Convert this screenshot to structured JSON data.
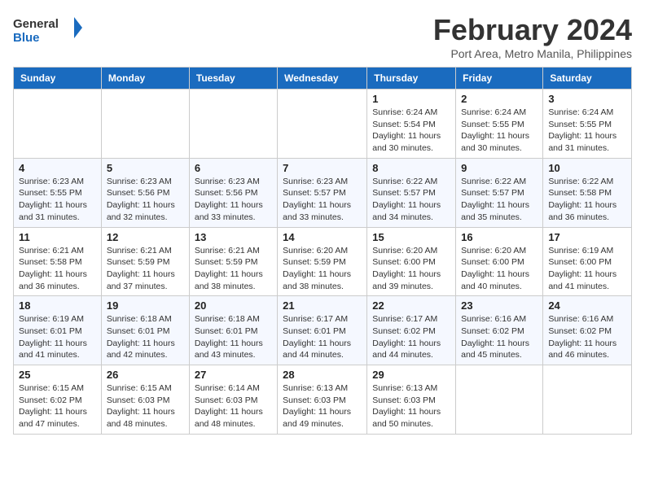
{
  "logo": {
    "line1": "General",
    "line2": "Blue"
  },
  "title": "February 2024",
  "location": "Port Area, Metro Manila, Philippines",
  "days_of_week": [
    "Sunday",
    "Monday",
    "Tuesday",
    "Wednesday",
    "Thursday",
    "Friday",
    "Saturday"
  ],
  "weeks": [
    [
      {
        "day": "",
        "info": ""
      },
      {
        "day": "",
        "info": ""
      },
      {
        "day": "",
        "info": ""
      },
      {
        "day": "",
        "info": ""
      },
      {
        "day": "1",
        "info": "Sunrise: 6:24 AM\nSunset: 5:54 PM\nDaylight: 11 hours and 30 minutes."
      },
      {
        "day": "2",
        "info": "Sunrise: 6:24 AM\nSunset: 5:55 PM\nDaylight: 11 hours and 30 minutes."
      },
      {
        "day": "3",
        "info": "Sunrise: 6:24 AM\nSunset: 5:55 PM\nDaylight: 11 hours and 31 minutes."
      }
    ],
    [
      {
        "day": "4",
        "info": "Sunrise: 6:23 AM\nSunset: 5:55 PM\nDaylight: 11 hours and 31 minutes."
      },
      {
        "day": "5",
        "info": "Sunrise: 6:23 AM\nSunset: 5:56 PM\nDaylight: 11 hours and 32 minutes."
      },
      {
        "day": "6",
        "info": "Sunrise: 6:23 AM\nSunset: 5:56 PM\nDaylight: 11 hours and 33 minutes."
      },
      {
        "day": "7",
        "info": "Sunrise: 6:23 AM\nSunset: 5:57 PM\nDaylight: 11 hours and 33 minutes."
      },
      {
        "day": "8",
        "info": "Sunrise: 6:22 AM\nSunset: 5:57 PM\nDaylight: 11 hours and 34 minutes."
      },
      {
        "day": "9",
        "info": "Sunrise: 6:22 AM\nSunset: 5:57 PM\nDaylight: 11 hours and 35 minutes."
      },
      {
        "day": "10",
        "info": "Sunrise: 6:22 AM\nSunset: 5:58 PM\nDaylight: 11 hours and 36 minutes."
      }
    ],
    [
      {
        "day": "11",
        "info": "Sunrise: 6:21 AM\nSunset: 5:58 PM\nDaylight: 11 hours and 36 minutes."
      },
      {
        "day": "12",
        "info": "Sunrise: 6:21 AM\nSunset: 5:59 PM\nDaylight: 11 hours and 37 minutes."
      },
      {
        "day": "13",
        "info": "Sunrise: 6:21 AM\nSunset: 5:59 PM\nDaylight: 11 hours and 38 minutes."
      },
      {
        "day": "14",
        "info": "Sunrise: 6:20 AM\nSunset: 5:59 PM\nDaylight: 11 hours and 38 minutes."
      },
      {
        "day": "15",
        "info": "Sunrise: 6:20 AM\nSunset: 6:00 PM\nDaylight: 11 hours and 39 minutes."
      },
      {
        "day": "16",
        "info": "Sunrise: 6:20 AM\nSunset: 6:00 PM\nDaylight: 11 hours and 40 minutes."
      },
      {
        "day": "17",
        "info": "Sunrise: 6:19 AM\nSunset: 6:00 PM\nDaylight: 11 hours and 41 minutes."
      }
    ],
    [
      {
        "day": "18",
        "info": "Sunrise: 6:19 AM\nSunset: 6:01 PM\nDaylight: 11 hours and 41 minutes."
      },
      {
        "day": "19",
        "info": "Sunrise: 6:18 AM\nSunset: 6:01 PM\nDaylight: 11 hours and 42 minutes."
      },
      {
        "day": "20",
        "info": "Sunrise: 6:18 AM\nSunset: 6:01 PM\nDaylight: 11 hours and 43 minutes."
      },
      {
        "day": "21",
        "info": "Sunrise: 6:17 AM\nSunset: 6:01 PM\nDaylight: 11 hours and 44 minutes."
      },
      {
        "day": "22",
        "info": "Sunrise: 6:17 AM\nSunset: 6:02 PM\nDaylight: 11 hours and 44 minutes."
      },
      {
        "day": "23",
        "info": "Sunrise: 6:16 AM\nSunset: 6:02 PM\nDaylight: 11 hours and 45 minutes."
      },
      {
        "day": "24",
        "info": "Sunrise: 6:16 AM\nSunset: 6:02 PM\nDaylight: 11 hours and 46 minutes."
      }
    ],
    [
      {
        "day": "25",
        "info": "Sunrise: 6:15 AM\nSunset: 6:02 PM\nDaylight: 11 hours and 47 minutes."
      },
      {
        "day": "26",
        "info": "Sunrise: 6:15 AM\nSunset: 6:03 PM\nDaylight: 11 hours and 48 minutes."
      },
      {
        "day": "27",
        "info": "Sunrise: 6:14 AM\nSunset: 6:03 PM\nDaylight: 11 hours and 48 minutes."
      },
      {
        "day": "28",
        "info": "Sunrise: 6:13 AM\nSunset: 6:03 PM\nDaylight: 11 hours and 49 minutes."
      },
      {
        "day": "29",
        "info": "Sunrise: 6:13 AM\nSunset: 6:03 PM\nDaylight: 11 hours and 50 minutes."
      },
      {
        "day": "",
        "info": ""
      },
      {
        "day": "",
        "info": ""
      }
    ]
  ]
}
